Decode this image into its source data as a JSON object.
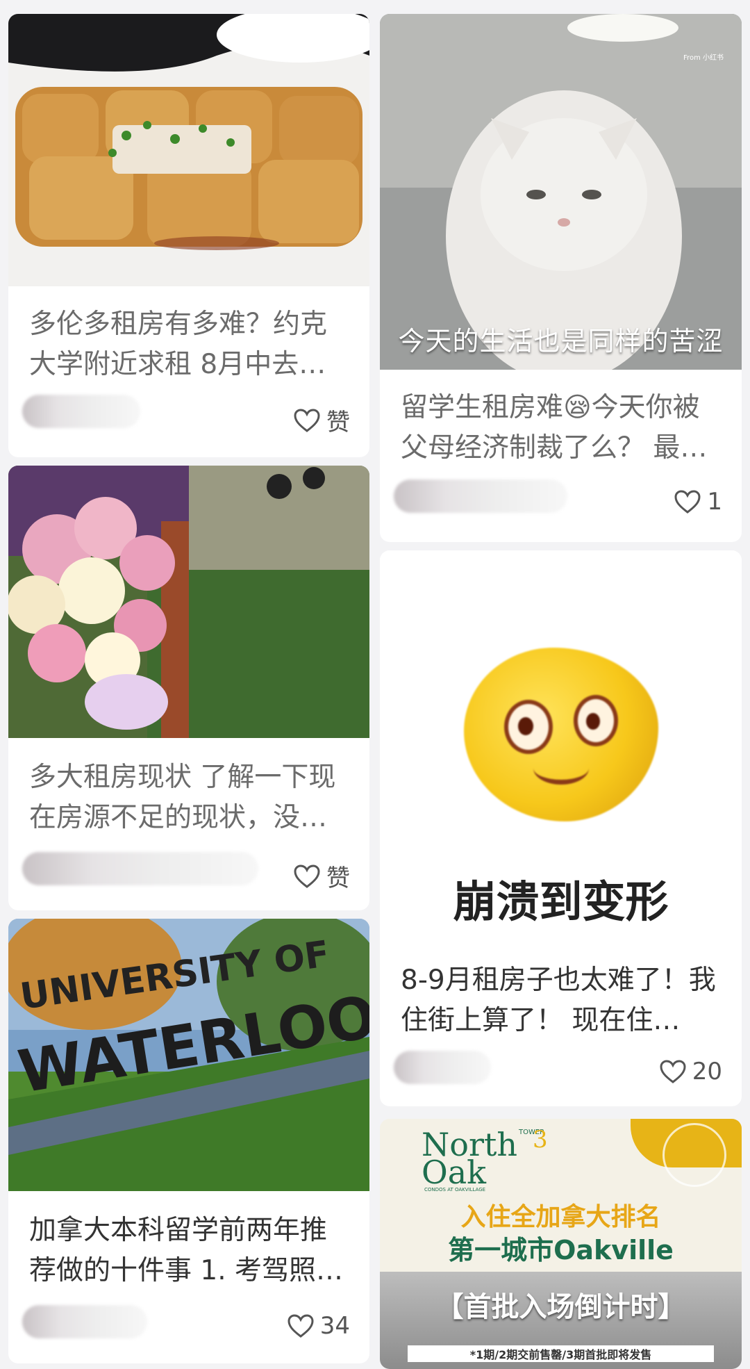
{
  "posts": [
    {
      "title": "多伦多租房有多难？约克大学附近求租 8月中去…",
      "like_label": "赞"
    },
    {
      "title": "留学生租房难😪今天你被父母经济制裁了么？ 最…",
      "overlay": "今天的生活也是同样的苦涩",
      "watermark": "From 小红书",
      "like_label": "1"
    },
    {
      "title": "多大租房现状 了解一下现在房源不足的现状，没…",
      "like_label": "赞"
    },
    {
      "title": "8-9月租房子也太难了！我住街上算了！ 现在住…",
      "image_caption": "崩溃到变形",
      "like_label": "20"
    },
    {
      "title": "加拿大本科留学前两年推荐做的十件事 1. 考驾照…",
      "sign_text_1": "UNIVERSITY OF",
      "sign_text_2": "WATERLOO",
      "like_label": "34"
    },
    {
      "ad_brand_1": "North",
      "ad_brand_2": "Oak",
      "ad_tower": "TOWER",
      "ad_tower_num": "3",
      "ad_sub": "CONDOS AT OAKVILLAGE",
      "ad_line1": "入住全加拿大排名",
      "ad_line2": "第一城市Oakville",
      "ad_banner": "【首批入场倒计时】",
      "ad_footer": "*1期/2期交前售罄/3期首批即将发售"
    }
  ],
  "icons": [
    "heart-icon"
  ],
  "colors": {
    "background": "#f3f3f5",
    "card": "#ffffff",
    "ad_green": "#1e6e4e",
    "ad_yellow": "#e7b417"
  }
}
